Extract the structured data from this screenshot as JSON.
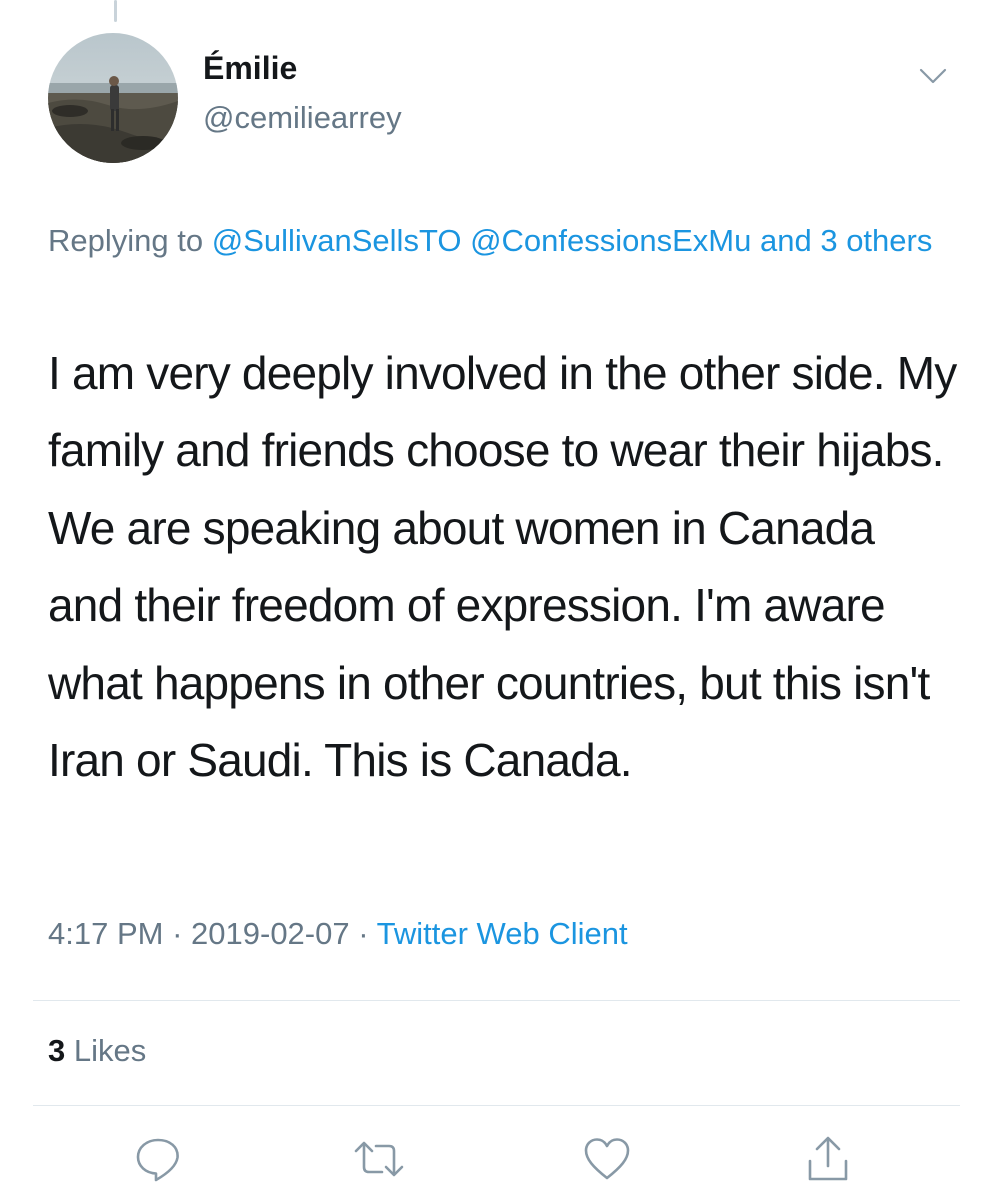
{
  "tweet": {
    "author": {
      "display_name": "Émilie",
      "handle": "@cemiliearrey"
    },
    "reply_context": {
      "prefix": "Replying to",
      "mentions": [
        "@SullivanSellsTO",
        "@ConfessionsExMu"
      ],
      "others": "and 3 others"
    },
    "text": "I am very deeply involved in the other side. My family and friends choose to wear their hijabs. We are speaking about women in Canada and their freedom of expression. I'm aware what happens in other countries, but this isn't Iran or Saudi. This is Canada.",
    "meta": {
      "time": "4:17 PM",
      "separator": "·",
      "date": "2019-02-07",
      "client": "Twitter Web Client"
    },
    "stats": {
      "likes_count": "3",
      "likes_label": "Likes"
    }
  },
  "icons": {
    "menu": "chevron-down-icon",
    "reply": "reply-icon",
    "retweet": "retweet-icon",
    "like": "heart-icon",
    "share": "share-icon"
  },
  "colors": {
    "link": "#1b95e0",
    "secondary_text": "#657786",
    "primary_text": "#14171a",
    "divider": "#e1e8ed"
  }
}
